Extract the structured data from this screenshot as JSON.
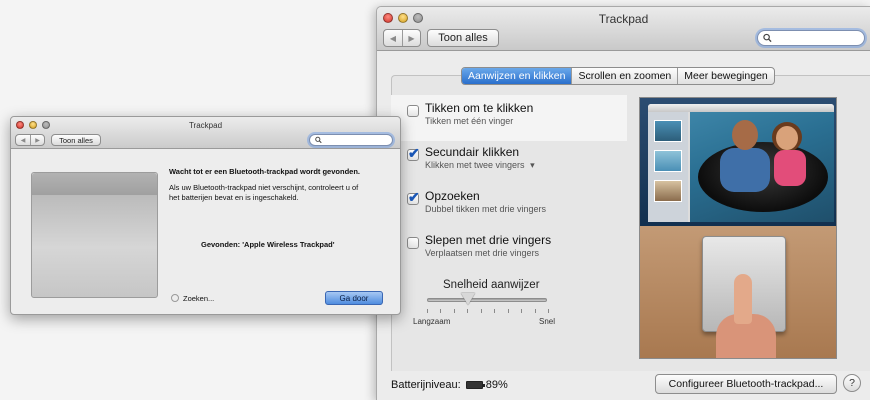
{
  "big_window": {
    "title": "Trackpad",
    "show_all": "Toon alles",
    "nav_back": "◀",
    "nav_forward": "▶",
    "search_value": "",
    "tabs": [
      {
        "label": "Aanwijzen en klikken",
        "active": true
      },
      {
        "label": "Scrollen en zoomen",
        "active": false
      },
      {
        "label": "Meer bewegingen",
        "active": false
      }
    ],
    "options": [
      {
        "title": "Tikken om te klikken",
        "subtitle": "Tikken met één vinger",
        "checked": false
      },
      {
        "title": "Secundair klikken",
        "subtitle": "Klikken met twee vingers",
        "checked": true
      },
      {
        "title": "Opzoeken",
        "subtitle": "Dubbel tikken met drie vingers",
        "checked": true
      },
      {
        "title": "Slepen met drie vingers",
        "subtitle": "Verplaatsen met drie vingers",
        "checked": false
      }
    ],
    "dropdown_arrow": "▾",
    "check_mark": "✔",
    "speed": {
      "title": "Snelheid aanwijzer",
      "slow_label": "Langzaam",
      "fast_label": "Snel"
    },
    "battery_label": "Batterijniveau:",
    "battery_value": "89%",
    "configure_button": "Configureer Bluetooth-trackpad...",
    "help_button": "?"
  },
  "small_window": {
    "title": "Trackpad",
    "show_all": "Toon alles",
    "nav_back": "◀",
    "nav_forward": "▶",
    "heading": "Wacht tot er een Bluetooth-trackpad wordt gevonden.",
    "body_line1": "Als uw Bluetooth-trackpad niet verschijnt, controleert u of",
    "body_line2": "het batterijen bevat en is ingeschakeld.",
    "found": "Gevonden: 'Apple Wireless Trackpad'",
    "searching": "Zoeken...",
    "continue_button": "Ga door"
  },
  "colors": {
    "accent": "#2a6fcc",
    "window_bg": "#ececec"
  }
}
